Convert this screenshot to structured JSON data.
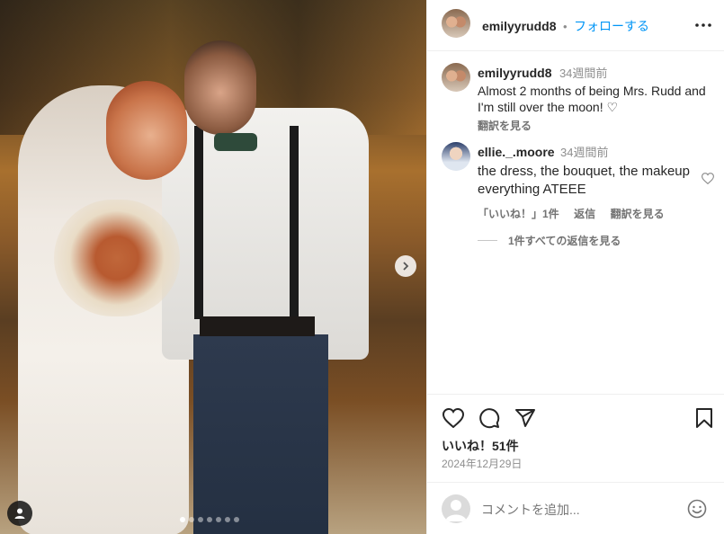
{
  "post": {
    "author": "emilyyrudd8",
    "follow_label": "フォローする",
    "more_label": "その他",
    "carousel_dots": 7,
    "active_dot": 0
  },
  "caption": {
    "username": "emilyyrudd8",
    "time": "34週間前",
    "text": "Almost 2 months of being Mrs. Rudd and I'm still over the moon! ♡",
    "translate": "翻訳を見る"
  },
  "comment": {
    "username": "ellie._.moore",
    "time": "34週間前",
    "text": "the dress, the bouquet, the makeup everything ATEEE",
    "likes": "「いいね！」1件",
    "reply": "返信",
    "translate": "翻訳を見る",
    "view_replies": "1件すべての返信を見る"
  },
  "stats": {
    "likes": "いいね！51件",
    "date": "2024年12月29日"
  },
  "add_comment": {
    "placeholder": "コメントを追加..."
  },
  "colors": {
    "link": "#0095f6",
    "text": "#262626",
    "muted": "#8e8e8e"
  }
}
